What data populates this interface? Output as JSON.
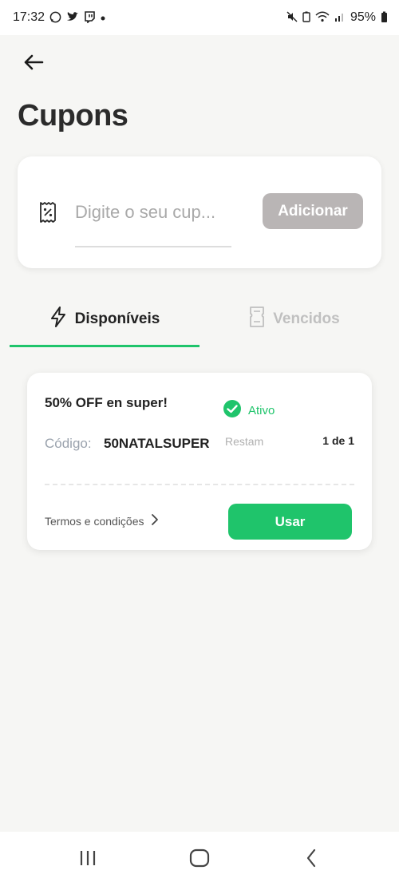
{
  "status_bar": {
    "time": "17:32",
    "battery": "95%",
    "left_icons": [
      "whatsapp-icon",
      "twitter-icon",
      "twitch-icon",
      "dot-icon"
    ],
    "right_icons": [
      "mute-icon",
      "battery-saver-icon",
      "wifi-icon",
      "signal-icon",
      "battery-icon"
    ]
  },
  "header": {
    "title": "Cupons"
  },
  "coupon_input": {
    "placeholder": "Digite o seu cup...",
    "add_label": "Adicionar"
  },
  "tabs": [
    {
      "label": "Disponíveis",
      "icon": "lightning-icon",
      "active": true
    },
    {
      "label": "Vencidos",
      "icon": "ticket-icon",
      "active": false
    }
  ],
  "coupon": {
    "title": "50% OFF en super!",
    "status": "Ativo",
    "code_label": "Código:",
    "code": "50NATALSUPER",
    "remaining_label": "Restam",
    "remaining": "1 de 1",
    "terms": "Termos e condições",
    "use_label": "Usar"
  },
  "colors": {
    "accent": "#1fc46b",
    "disabled_button": "#b9b5b5",
    "background": "#f6f6f4"
  }
}
